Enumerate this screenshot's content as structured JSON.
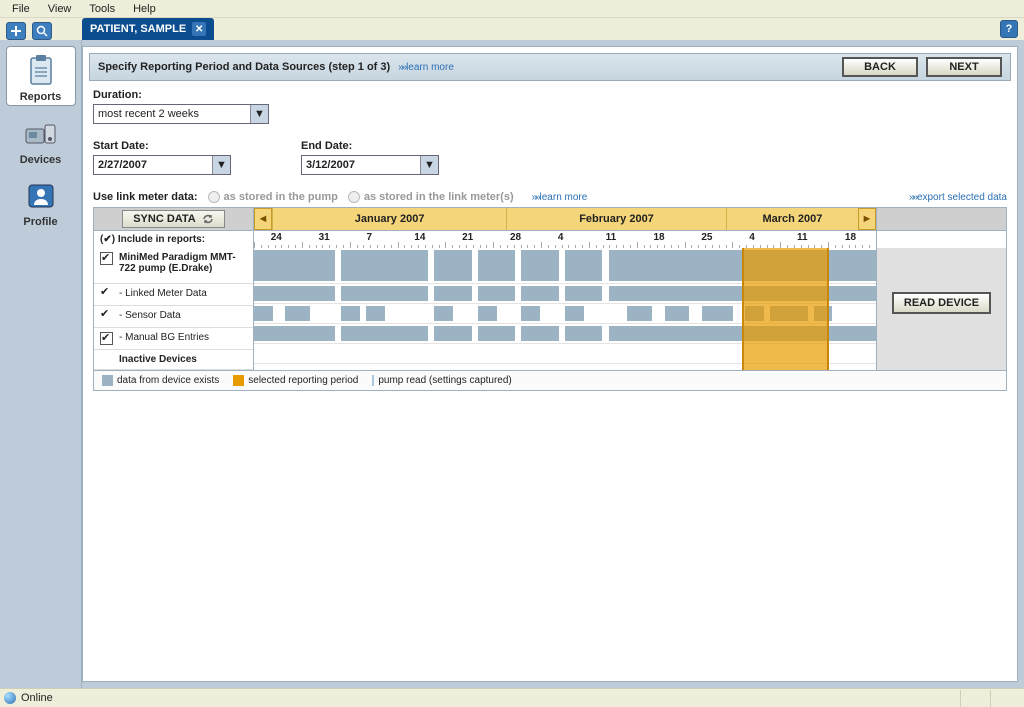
{
  "menu": [
    "File",
    "View",
    "Tools",
    "Help"
  ],
  "tab": {
    "title": "PATIENT, SAMPLE"
  },
  "sidebar": [
    {
      "key": "reports",
      "label": "Reports",
      "active": true
    },
    {
      "key": "devices",
      "label": "Devices",
      "active": false
    },
    {
      "key": "profile",
      "label": "Profile",
      "active": false
    }
  ],
  "step": {
    "title": "Specify Reporting Period and Data Sources (step 1 of 3)",
    "learn_more": "learn more",
    "back": "BACK",
    "next": "NEXT"
  },
  "form": {
    "duration_label": "Duration:",
    "duration_value": "most recent 2 weeks",
    "start_label": "Start Date:",
    "start_value": "2/27/2007",
    "end_label": "End Date:",
    "end_value": "3/12/2007",
    "linkmeter_label": "Use link meter data:",
    "radio_pump": "as stored in the pump",
    "radio_meter": "as stored in the link meter(s)",
    "learn_more": "learn more",
    "export": "export selected data"
  },
  "timeline": {
    "sync_label": "SYNC DATA",
    "months": [
      "January 2007",
      "February 2007",
      "March 2007"
    ],
    "day_labels": [
      24,
      31,
      7,
      14,
      21,
      28,
      4,
      11,
      18,
      25,
      4,
      11,
      18
    ],
    "include_label": "Include in reports:",
    "read_device": "READ DEVICE",
    "rows": [
      {
        "label": "MiniMed Paradigm MMT-722 pump (E.Drake)",
        "bold": true,
        "box": true,
        "checked": true,
        "tall": true
      },
      {
        "label": "- Linked Meter Data",
        "bold": false,
        "box": false,
        "checked": true,
        "tall": false
      },
      {
        "label": "- Sensor Data",
        "bold": false,
        "box": false,
        "checked": true,
        "tall": false
      },
      {
        "label": "- Manual BG Entries",
        "bold": false,
        "box": true,
        "checked": true,
        "tall": false
      },
      {
        "label": "Inactive Devices",
        "bold": true,
        "box": null,
        "checked": false,
        "tall": false
      }
    ],
    "selection": {
      "left_pct": 78.5,
      "width_pct": 14
    },
    "legend": {
      "exists": "data from device exists",
      "selected": "selected reporting period",
      "pumpread": "pump read (settings captured)"
    },
    "colors": {
      "data": "#9cb3c4",
      "selected": "#e89b00",
      "pumpread": "#a7c8e0"
    }
  },
  "status": {
    "text": "Online"
  }
}
